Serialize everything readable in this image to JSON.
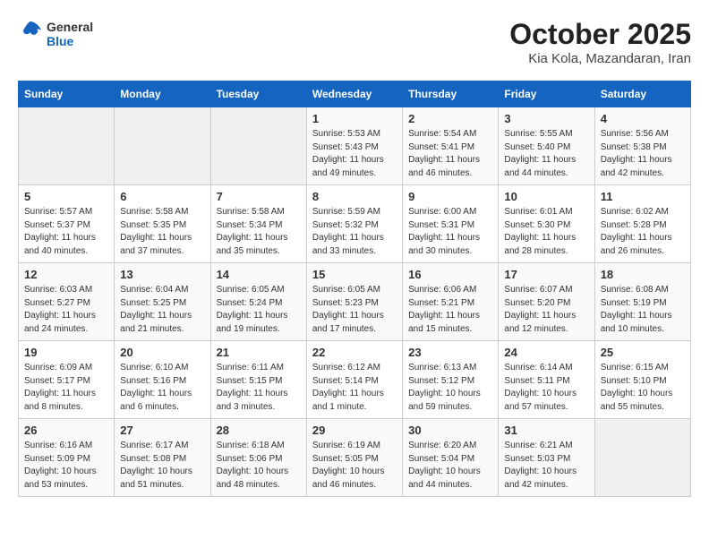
{
  "header": {
    "logo_general": "General",
    "logo_blue": "Blue",
    "month_title": "October 2025",
    "location": "Kia Kola, Mazandaran, Iran"
  },
  "weekdays": [
    "Sunday",
    "Monday",
    "Tuesday",
    "Wednesday",
    "Thursday",
    "Friday",
    "Saturday"
  ],
  "weeks": [
    [
      {
        "day": "",
        "detail": ""
      },
      {
        "day": "",
        "detail": ""
      },
      {
        "day": "",
        "detail": ""
      },
      {
        "day": "1",
        "detail": "Sunrise: 5:53 AM\nSunset: 5:43 PM\nDaylight: 11 hours\nand 49 minutes."
      },
      {
        "day": "2",
        "detail": "Sunrise: 5:54 AM\nSunset: 5:41 PM\nDaylight: 11 hours\nand 46 minutes."
      },
      {
        "day": "3",
        "detail": "Sunrise: 5:55 AM\nSunset: 5:40 PM\nDaylight: 11 hours\nand 44 minutes."
      },
      {
        "day": "4",
        "detail": "Sunrise: 5:56 AM\nSunset: 5:38 PM\nDaylight: 11 hours\nand 42 minutes."
      }
    ],
    [
      {
        "day": "5",
        "detail": "Sunrise: 5:57 AM\nSunset: 5:37 PM\nDaylight: 11 hours\nand 40 minutes."
      },
      {
        "day": "6",
        "detail": "Sunrise: 5:58 AM\nSunset: 5:35 PM\nDaylight: 11 hours\nand 37 minutes."
      },
      {
        "day": "7",
        "detail": "Sunrise: 5:58 AM\nSunset: 5:34 PM\nDaylight: 11 hours\nand 35 minutes."
      },
      {
        "day": "8",
        "detail": "Sunrise: 5:59 AM\nSunset: 5:32 PM\nDaylight: 11 hours\nand 33 minutes."
      },
      {
        "day": "9",
        "detail": "Sunrise: 6:00 AM\nSunset: 5:31 PM\nDaylight: 11 hours\nand 30 minutes."
      },
      {
        "day": "10",
        "detail": "Sunrise: 6:01 AM\nSunset: 5:30 PM\nDaylight: 11 hours\nand 28 minutes."
      },
      {
        "day": "11",
        "detail": "Sunrise: 6:02 AM\nSunset: 5:28 PM\nDaylight: 11 hours\nand 26 minutes."
      }
    ],
    [
      {
        "day": "12",
        "detail": "Sunrise: 6:03 AM\nSunset: 5:27 PM\nDaylight: 11 hours\nand 24 minutes."
      },
      {
        "day": "13",
        "detail": "Sunrise: 6:04 AM\nSunset: 5:25 PM\nDaylight: 11 hours\nand 21 minutes."
      },
      {
        "day": "14",
        "detail": "Sunrise: 6:05 AM\nSunset: 5:24 PM\nDaylight: 11 hours\nand 19 minutes."
      },
      {
        "day": "15",
        "detail": "Sunrise: 6:05 AM\nSunset: 5:23 PM\nDaylight: 11 hours\nand 17 minutes."
      },
      {
        "day": "16",
        "detail": "Sunrise: 6:06 AM\nSunset: 5:21 PM\nDaylight: 11 hours\nand 15 minutes."
      },
      {
        "day": "17",
        "detail": "Sunrise: 6:07 AM\nSunset: 5:20 PM\nDaylight: 11 hours\nand 12 minutes."
      },
      {
        "day": "18",
        "detail": "Sunrise: 6:08 AM\nSunset: 5:19 PM\nDaylight: 11 hours\nand 10 minutes."
      }
    ],
    [
      {
        "day": "19",
        "detail": "Sunrise: 6:09 AM\nSunset: 5:17 PM\nDaylight: 11 hours\nand 8 minutes."
      },
      {
        "day": "20",
        "detail": "Sunrise: 6:10 AM\nSunset: 5:16 PM\nDaylight: 11 hours\nand 6 minutes."
      },
      {
        "day": "21",
        "detail": "Sunrise: 6:11 AM\nSunset: 5:15 PM\nDaylight: 11 hours\nand 3 minutes."
      },
      {
        "day": "22",
        "detail": "Sunrise: 6:12 AM\nSunset: 5:14 PM\nDaylight: 11 hours\nand 1 minute."
      },
      {
        "day": "23",
        "detail": "Sunrise: 6:13 AM\nSunset: 5:12 PM\nDaylight: 10 hours\nand 59 minutes."
      },
      {
        "day": "24",
        "detail": "Sunrise: 6:14 AM\nSunset: 5:11 PM\nDaylight: 10 hours\nand 57 minutes."
      },
      {
        "day": "25",
        "detail": "Sunrise: 6:15 AM\nSunset: 5:10 PM\nDaylight: 10 hours\nand 55 minutes."
      }
    ],
    [
      {
        "day": "26",
        "detail": "Sunrise: 6:16 AM\nSunset: 5:09 PM\nDaylight: 10 hours\nand 53 minutes."
      },
      {
        "day": "27",
        "detail": "Sunrise: 6:17 AM\nSunset: 5:08 PM\nDaylight: 10 hours\nand 51 minutes."
      },
      {
        "day": "28",
        "detail": "Sunrise: 6:18 AM\nSunset: 5:06 PM\nDaylight: 10 hours\nand 48 minutes."
      },
      {
        "day": "29",
        "detail": "Sunrise: 6:19 AM\nSunset: 5:05 PM\nDaylight: 10 hours\nand 46 minutes."
      },
      {
        "day": "30",
        "detail": "Sunrise: 6:20 AM\nSunset: 5:04 PM\nDaylight: 10 hours\nand 44 minutes."
      },
      {
        "day": "31",
        "detail": "Sunrise: 6:21 AM\nSunset: 5:03 PM\nDaylight: 10 hours\nand 42 minutes."
      },
      {
        "day": "",
        "detail": ""
      }
    ]
  ]
}
